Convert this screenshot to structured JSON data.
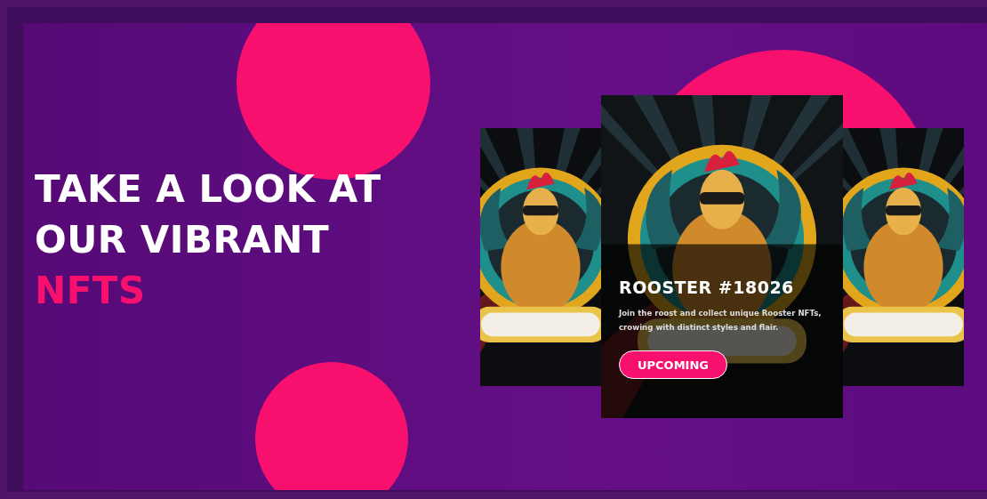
{
  "heading": {
    "lines": [
      "TAKE A LOOK AT",
      "OUR VIBRANT"
    ],
    "highlight": "NFTS"
  },
  "cards": [
    {
      "kind": "side"
    },
    {
      "kind": "featured",
      "title": "ROOSTER #18026",
      "description": "Join the roost and collect unique Rooster NFTs, crowing with distinct styles and flair.",
      "button": "UPCOMING"
    },
    {
      "kind": "side"
    }
  ]
}
